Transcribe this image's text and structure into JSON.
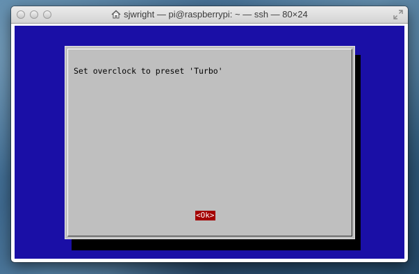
{
  "window": {
    "title": "sjwright — pi@raspberrypi: ~ — ssh — 80×24",
    "title_icon": "home-icon",
    "fullscreen_icon": "fullscreen-arrows-icon"
  },
  "terminal": {
    "background_color": "#1a0fa6",
    "dialog": {
      "message": "Set overclock to preset 'Turbo'",
      "ok_label": "<Ok>",
      "ok_highlight_color": "#a30000",
      "dialog_color": "#bfbfbf"
    }
  }
}
